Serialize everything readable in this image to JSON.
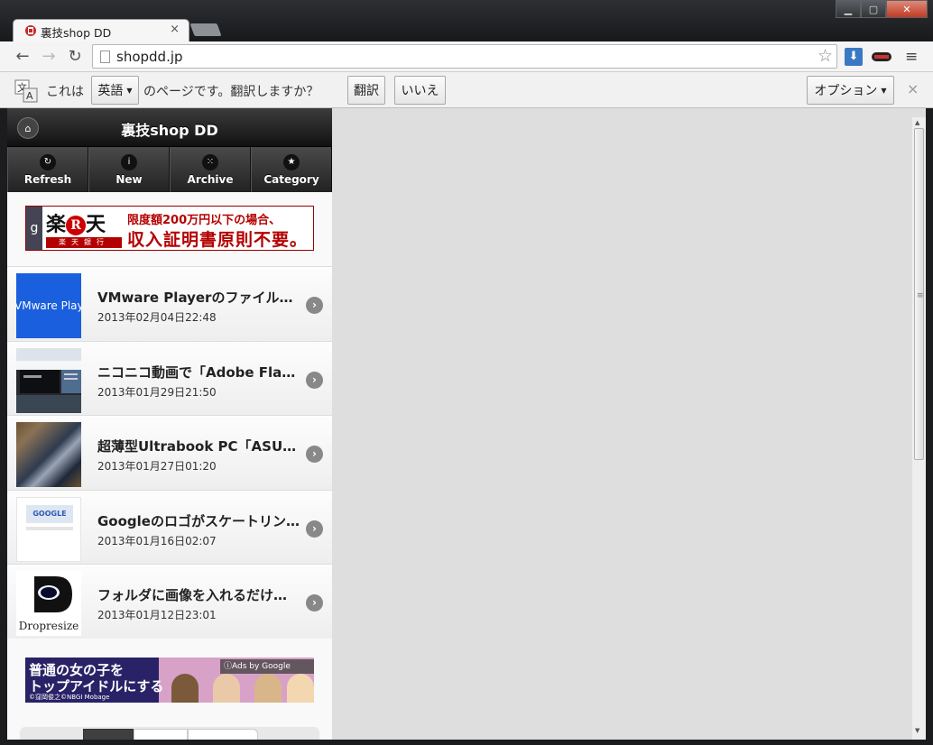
{
  "window": {
    "tab_title": "裏技shop DD",
    "tab_close": "×",
    "minimize": "▁",
    "maximize": "▢",
    "close": "✕"
  },
  "toolbar": {
    "back": "←",
    "forward": "→",
    "reload": "↻",
    "url": "shopdd.jp",
    "star": "☆",
    "menu": "≡",
    "download_icon": "download-extension-icon",
    "mask_icon": "mask-extension-icon"
  },
  "translate_bar": {
    "prefix": "これは",
    "language": "英語",
    "middle": "のページです。翻訳しますか？",
    "translate_button": "翻訳",
    "no_button": "いいえ",
    "options_button": "オプション",
    "close": "×"
  },
  "mobile_page": {
    "title": "裏技shop DD",
    "home_icon": "home-icon",
    "nav": [
      {
        "label": "Refresh",
        "icon": "↻"
      },
      {
        "label": "New",
        "icon": "i"
      },
      {
        "label": "Archive",
        "icon": "⁙"
      },
      {
        "label": "Category",
        "icon": "★"
      }
    ],
    "top_banner": {
      "g": "g",
      "logo_left": "楽",
      "logo_r": "R",
      "logo_right": "天",
      "logo_bank": "楽天銀行",
      "line1": "限度額200万円以下の場合、",
      "line2": "収入証明書原則不要。"
    },
    "articles": [
      {
        "title": "VMware Playerのファイルサ…",
        "date": "2013年02月04日22:48",
        "thumb_text": "VMware Player"
      },
      {
        "title": "ニコニコ動画で「Adobe Flas…",
        "date": "2013年01月29日21:50",
        "thumb_text": ""
      },
      {
        "title": "超薄型Ultrabook PC「ASUS …",
        "date": "2013年01月27日01:20",
        "thumb_text": ""
      },
      {
        "title": "Googleのロゴがスケートリン…",
        "date": "2013年01月16日02:07",
        "thumb_text": "GOOGLE"
      },
      {
        "title": "フォルダに画像を入れるだけ…",
        "date": "2013年01月12日23:01",
        "thumb_text": "Dropresize"
      }
    ],
    "bottom_banner": {
      "line1": "普通の女の子を",
      "line2": "トップアイドルにする",
      "copyright": "©窪岡俊之©NBGI Mobage",
      "ads_label": "ⓘAds by Google"
    },
    "arrow": "›"
  },
  "scrollbar": {
    "up": "▲",
    "down": "▼",
    "grip": "≡"
  }
}
